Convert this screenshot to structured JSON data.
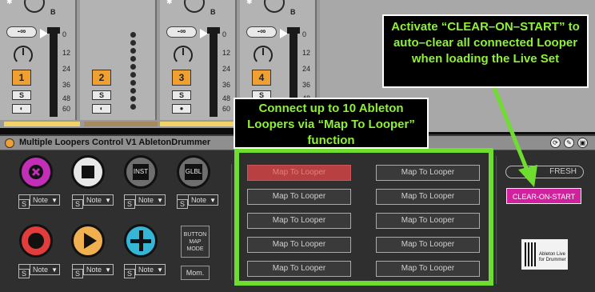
{
  "mixer": {
    "volume_label": "-∞",
    "scale": [
      "0",
      "12",
      "24",
      "36",
      "48",
      "60"
    ],
    "sends_label": "B",
    "tracks": [
      {
        "number": "1"
      },
      {
        "number": "2"
      },
      {
        "number": "3"
      },
      {
        "number": "4"
      }
    ],
    "solo_label": "S"
  },
  "device": {
    "title": "Multiple Loopers Control V1 AbletonDrummer",
    "pads": {
      "note_label": "Note",
      "s_label": "S",
      "inst_label": "INST",
      "glbl_label": "GLBL",
      "button_map_mode_label": "BUTTON\nMAP\nMODE",
      "mom_label": "Mom."
    },
    "map_buttons": [
      "Map To Looper",
      "Map To Looper",
      "Map To Looper",
      "Map To Looper",
      "Map To Looper",
      "Map To Looper",
      "Map To Looper",
      "Map To Looper",
      "Map To Looper",
      "Map To Looper"
    ],
    "fresh_label": "FRESH",
    "clear_on_start_label": "CLEAR-ON-START",
    "logo_text": "Ableton Live for Drummer"
  },
  "annotations": {
    "callout_top": "Activate “CLEAR–ON–START” to auto–clear all connected Looper when loading the Live Set",
    "callout_middle": "Connect up to 10 Ableton Loopers via “Map To Looper” function"
  },
  "colors": {
    "accent_green": "#6fdd2f",
    "clear_on_start": "#d2219e",
    "track_orange": "#f0a030"
  }
}
